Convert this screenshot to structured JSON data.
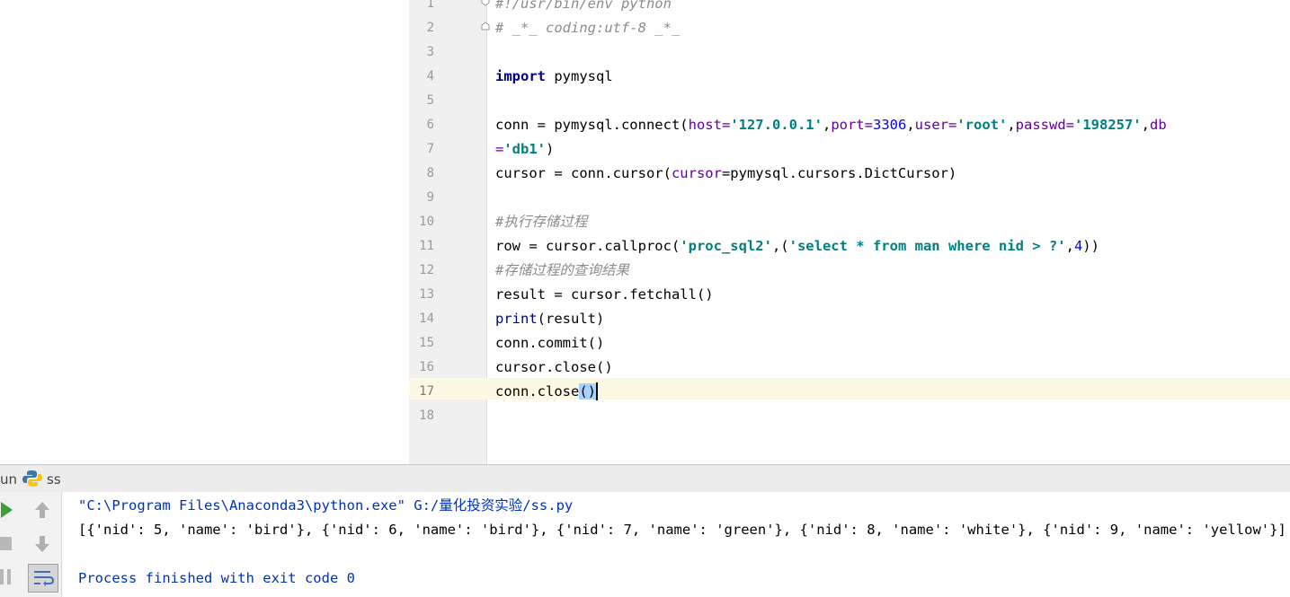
{
  "editor": {
    "line_numbers": [
      "1",
      "2",
      "3",
      "4",
      "5",
      "6",
      "7",
      "8",
      "9",
      "10",
      "11",
      "12",
      "13",
      "14",
      "15",
      "16",
      "17",
      "18"
    ],
    "current_line": "17",
    "lines": {
      "l1": "#!/usr/bin/env python",
      "l2": "# _*_ coding:utf-8 _*_",
      "l4_kw": "import",
      "l4_rest": " pymysql",
      "l6_a": "conn = pymysql.connect(",
      "l6_host_k": "host=",
      "l6_host_v": "'127.0.0.1'",
      "l6_port_k": "port=",
      "l6_port_v": "3306",
      "l6_user_k": "user=",
      "l6_user_v": "'root'",
      "l6_pw_k": "passwd=",
      "l6_pw_v": "'198257'",
      "l6_db_k": "db",
      "l7_k": "=",
      "l7_v": "'db1'",
      "l7_end": ")",
      "l8_a": "cursor = conn.cursor(",
      "l8_k": "cursor",
      "l8_b": "=pymysql.cursors.DictCursor)",
      "l10": "#执行存储过程",
      "l11_a": "row = cursor.callproc(",
      "l11_s1": "'proc_sql2'",
      "l11_b": ",(",
      "l11_s2": "'select * from man where nid > ?'",
      "l11_c": ",",
      "l11_n": "4",
      "l11_d": "))",
      "l12": "#存储过程的查询结果",
      "l13": "result = cursor.fetchall()",
      "l14_bi": "print",
      "l14_rest": "(result)",
      "l15": "conn.commit()",
      "l16": "cursor.close()",
      "l17_a": "conn.close",
      "l17_sel": "()"
    }
  },
  "run_panel": {
    "title": "un",
    "tab_label": "ss",
    "console": {
      "line1": "\"C:\\Program Files\\Anaconda3\\python.exe\" G:/量化投资实验/ss.py",
      "line2": "[{'nid': 5, 'name': 'bird'}, {'nid': 6, 'name': 'bird'}, {'nid': 7, 'name': 'green'}, {'nid': 8, 'name': 'white'}, {'nid': 9, 'name': 'yellow'}]",
      "line3": "Process finished with exit code 0"
    },
    "icons": [
      "python-icon",
      "run-icon",
      "stop-icon",
      "pause-icon",
      "up-arrow-icon",
      "down-arrow-icon",
      "soft-wrap-icon"
    ]
  },
  "colors": {
    "comment": "#8c8c8c",
    "keyword": "#000080",
    "string": "#008080",
    "param": "#660099",
    "number": "#0000ff",
    "current_line": "#fdf8e3",
    "selection": "#a6d2ff",
    "console_command": "#0033b3"
  }
}
